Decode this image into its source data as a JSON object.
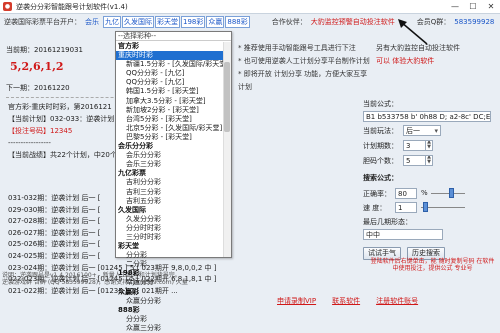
{
  "window": {
    "title": "逆袭分分彩智能跟号计划软件(v1.4)",
    "min": "—",
    "max": "☐",
    "close": "✕"
  },
  "top": {
    "org_label": "逆袭国际彩票平台开户：",
    "org_link": "会乐",
    "tabs": [
      "九亿",
      "久发国际",
      "彩天堂",
      "198彩",
      "众赢",
      "888彩"
    ],
    "partner_label": "合作伙伴：",
    "partner_value": "大豹监控预警自动投注软件",
    "member_label": "会员Q群：",
    "member_value": "583599928"
  },
  "left": {
    "period": "当前期：20161219031",
    "nums": "5,2,6,1,2",
    "stat": "下一期：20161220",
    "current_plan": "官方彩-重庆时时彩，第2016121",
    "plan_lines": [
      {
        "text": "【当前计划】032-033：逆袭计划",
        "red": false
      },
      {
        "text": "【投注号码】12345",
        "red": true
      }
    ],
    "divider": "-----------------",
    "summary": "【当前战绩】共22个计划，中20个",
    "records": [
      "031-032期：逆袭计划 后一 [",
      "029-030期：逆袭计划 后一 [",
      "027-028期：逆袭计划 后一 [",
      "026-027期：逆袭计划 后一 [",
      "025-026期：逆袭计划 后一 [",
      "024-025期：逆袭计划 后一 [",
      "023-024期：逆袭计划 后一 [01245 ] 5 [ 023期开 9,8,0,0,2 中 ]",
      "022-023期：逆袭计划 后一 [01245 ] 5 [ 022期开 6,8,1,8,1 中 ]",
      "021-022期：逆袭计划 后一 [01235 ] 2 [ 021期开 ..."
    ],
    "hint": [
      "说明：逆袭跟号是v1.4 2016100+，新量人工跟号和计划背景完。",
      "逆袭游戏群 合群 (QQ 583599928)，感谢支持 (jhna599.com) 大量"
    ]
  },
  "dropdown": {
    "header": "--选择彩种--",
    "items": [
      {
        "text": "官方彩",
        "kind": "grp"
      },
      {
        "text": "重庆时时彩",
        "kind": "sel"
      },
      {
        "text": "新疆1.5分彩 - [久发国际/彩天堂]",
        "kind": "it"
      },
      {
        "text": "QQ分分彩 - [九亿]",
        "kind": "it"
      },
      {
        "text": "QQ分分彩 - [九亿]",
        "kind": "it"
      },
      {
        "text": "韩国1.5分彩 - [彩天堂]",
        "kind": "it"
      },
      {
        "text": "加拿大3.5分彩 - [彩天堂]",
        "kind": "it"
      },
      {
        "text": "新加坡2分彩 - [彩天堂]",
        "kind": "it"
      },
      {
        "text": "台湾5分彩 - [彩天堂]",
        "kind": "it"
      },
      {
        "text": "北京5分彩 - [久发国际/彩天堂]",
        "kind": "it"
      },
      {
        "text": "巴黎5分彩 - [彩天堂]",
        "kind": "it"
      },
      {
        "text": "会乐分分彩",
        "kind": "grp"
      },
      {
        "text": "会乐分分彩",
        "kind": "it"
      },
      {
        "text": "会乐三分彩",
        "kind": "it"
      },
      {
        "text": "九亿彩票",
        "kind": "grp"
      },
      {
        "text": "吉利分分彩",
        "kind": "it"
      },
      {
        "text": "吉利三分彩",
        "kind": "it"
      },
      {
        "text": "吉利五分彩",
        "kind": "it"
      },
      {
        "text": "久发国际",
        "kind": "grp"
      },
      {
        "text": "久发分分彩",
        "kind": "it"
      },
      {
        "text": "分分时时彩",
        "kind": "it"
      },
      {
        "text": "三分时时彩",
        "kind": "it"
      },
      {
        "text": "彩天堂",
        "kind": "grp"
      },
      {
        "text": "分分彩",
        "kind": "it"
      },
      {
        "text": "二分彩",
        "kind": "it"
      },
      {
        "text": "198彩",
        "kind": "grp"
      },
      {
        "text": "幸运分分",
        "kind": "it"
      },
      {
        "text": "众赢彩",
        "kind": "grp"
      },
      {
        "text": "众赢分分彩",
        "kind": "it"
      },
      {
        "text": "888彩",
        "kind": "grp"
      },
      {
        "text": "分分彩",
        "kind": "it"
      },
      {
        "text": "众赢三分彩",
        "kind": "it"
      }
    ]
  },
  "notes_mid": [
    {
      "text": "* 推荐使用手动智能跟号工具进行下注",
      "red": false
    },
    {
      "text": "* 也可使用逆袭人工计划分享平台制作计划",
      "red": false
    },
    {
      "text": "* 即将开放 计划分享 功能，方便大家互享",
      "red": false
    },
    {
      "text": "计划",
      "red": false
    }
  ],
  "notes_right": [
    {
      "text": "另有大豹监控自动投注软件",
      "red": false
    },
    {
      "text": "可以 体验大豹软件",
      "red": true
    }
  ],
  "panel": {
    "current_formula_label": "当前公式：",
    "formula_value": "B1 b533758 b' 0h88 D; a2-8c' DC;E",
    "play_label": "当前玩法：",
    "play_value": "后一",
    "plan_periods_label": "计划期数：",
    "plan_periods_value": "3",
    "pick_count_label": "胆码个数：",
    "pick_count_value": "5",
    "search_label": "搜索公式：",
    "acc_label": "正确率：",
    "acc_value": "80",
    "acc_unit": "%",
    "speed_label": "速 度：",
    "speed_value": "1",
    "min_streak_label": "最后几期形态：",
    "streak_value": "中中",
    "test_btn": "试试手气",
    "history_btn": "历史搜索",
    "warning": "登陆软件后右键单击，能 随时复制号码 在软件中使用投注，提供公式 专业号"
  },
  "bottom": [
    "申请录制VIP",
    "联系软件",
    "注册软件账号"
  ],
  "colors": {
    "accent": "#1a56c8",
    "warn": "#d01818"
  }
}
